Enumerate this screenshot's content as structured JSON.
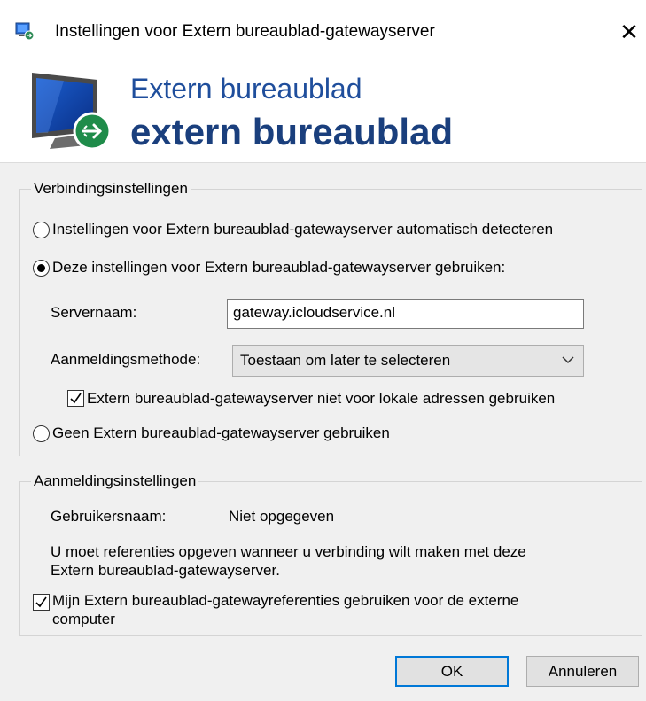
{
  "window": {
    "title": "Instellingen voor Extern bureaublad-gatewayserver",
    "close_glyph": "✕"
  },
  "banner": {
    "subtitle": "Extern bureaublad",
    "title": "extern bureaublad",
    "icon": "remote-desktop-monitor-icon"
  },
  "connection": {
    "legend": "Verbindingsinstellingen",
    "radio_auto": "Instellingen voor Extern bureaublad-gatewayserver automatisch detecteren",
    "radio_use": "Deze instellingen voor Extern bureaublad-gatewayserver gebruiken:",
    "servername_label": "Servernaam:",
    "servername_value": "gateway.icloudservice.nl",
    "logon_method_label": "Aanmeldingsmethode:",
    "logon_method_value": "Toestaan om later te selecteren",
    "bypass_local_label": "Extern bureaublad-gatewayserver niet voor lokale adressen gebruiken",
    "radio_none": "Geen Extern bureaublad-gatewayserver gebruiken",
    "selected": "use",
    "bypass_local_checked": true
  },
  "logon": {
    "legend": "Aanmeldingsinstellingen",
    "username_label": "Gebruikersnaam:",
    "username_value": "Niet opgegeven",
    "info_text_line1": "U moet referenties opgeven wanneer u verbinding wilt maken met deze",
    "info_text_line2": "Extern bureaublad-gatewayserver.",
    "use_credentials_line1": "Mijn Extern bureaublad-gatewayreferenties gebruiken voor de externe",
    "use_credentials_line2": "computer",
    "use_credentials_checked": true
  },
  "buttons": {
    "ok": "OK",
    "cancel": "Annuleren"
  },
  "colors": {
    "accent": "#0078d7",
    "banner_text": "#1f4e9c"
  }
}
